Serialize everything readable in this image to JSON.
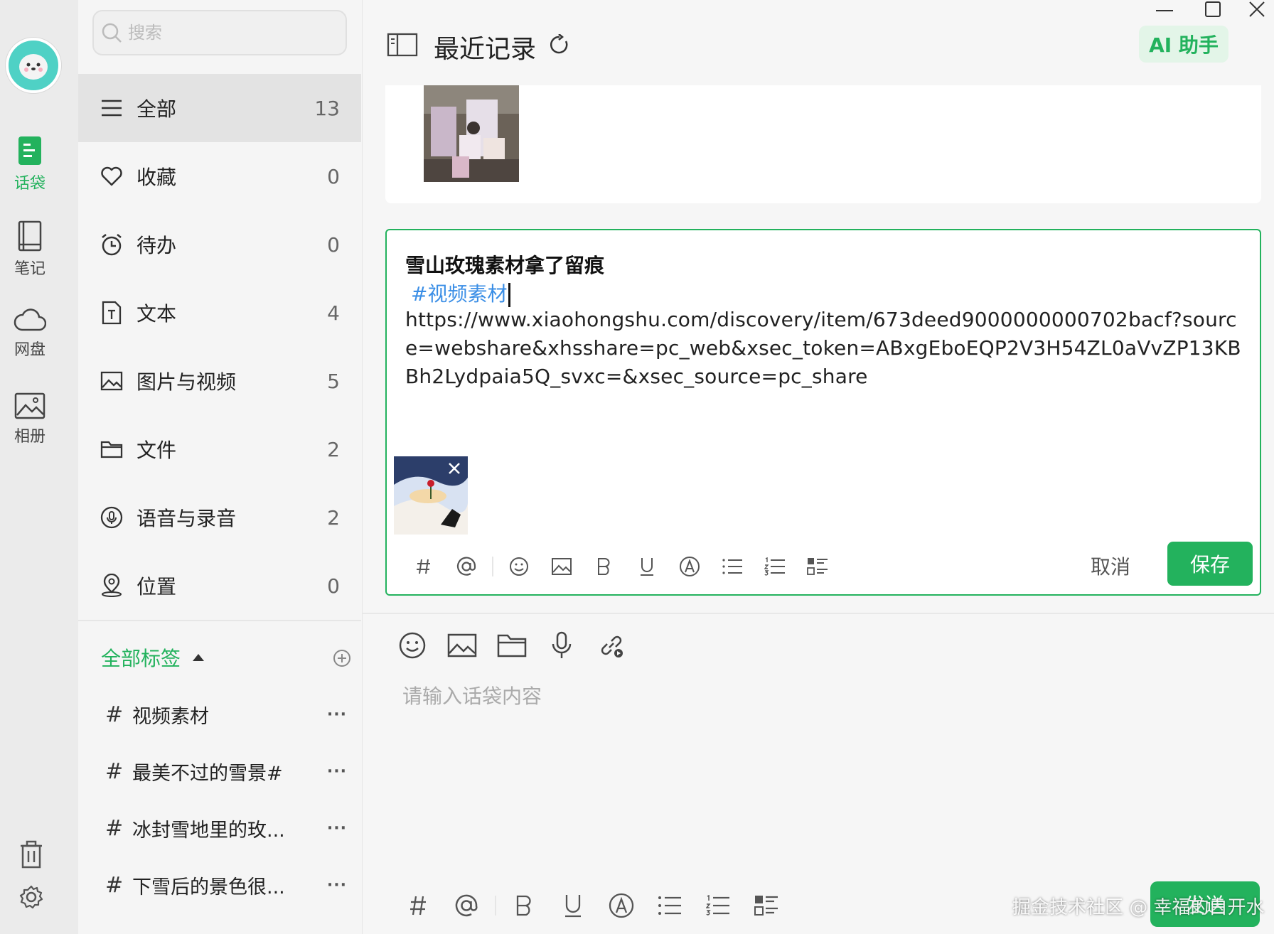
{
  "colors": {
    "accent": "#23b25d",
    "link": "#3a8ee6",
    "rail_bg": "#ebebeb"
  },
  "rail": {
    "items": [
      {
        "label": "话袋",
        "icon": "bag-icon",
        "active": true
      },
      {
        "label": "笔记",
        "icon": "notebook-icon",
        "active": false
      },
      {
        "label": "网盘",
        "icon": "cloud-icon",
        "active": false
      },
      {
        "label": "相册",
        "icon": "album-icon",
        "active": false
      }
    ],
    "bottom_icons": [
      "trash-icon",
      "gear-icon"
    ]
  },
  "search": {
    "placeholder": "搜索"
  },
  "categories": [
    {
      "label": "全部",
      "count": "13",
      "icon": "list-icon"
    },
    {
      "label": "收藏",
      "count": "0",
      "icon": "heart-icon"
    },
    {
      "label": "待办",
      "count": "0",
      "icon": "alarm-icon"
    },
    {
      "label": "文本",
      "count": "4",
      "icon": "text-file-icon"
    },
    {
      "label": "图片与视频",
      "count": "5",
      "icon": "image-icon"
    },
    {
      "label": "文件",
      "count": "2",
      "icon": "folder-icon"
    },
    {
      "label": "语音与录音",
      "count": "2",
      "icon": "mic-icon"
    },
    {
      "label": "位置",
      "count": "0",
      "icon": "location-icon"
    }
  ],
  "tags": {
    "header": "全部标签",
    "items": [
      {
        "hash": "#",
        "label": "视频素材"
      },
      {
        "hash": "#",
        "label": "最美不过的雪景#"
      },
      {
        "hash": "#",
        "label": "冰封雪地里的玫..."
      },
      {
        "hash": "#",
        "label": "下雪后的景色很..."
      }
    ],
    "more": "···"
  },
  "header": {
    "title": "最近记录",
    "ai_button": "AI 助手"
  },
  "editor": {
    "title": "雪山玫瑰素材拿了留痕",
    "tag": "#视频素材",
    "url": "https://www.xiaohongshu.com/discovery/item/673deed9000000000702bacf?source=webshare&xhsshare=pc_web&xsec_token=ABxgEboEQP2V3H54ZL0aVvZP13KBBh2Lydpaia5Q_svxc=&xsec_source=pc_share",
    "cancel": "取消",
    "save": "保存"
  },
  "compose": {
    "placeholder": "请输入话袋内容",
    "send": "发送",
    "watermark": "掘金技术社区 @ 幸福的白开水"
  }
}
